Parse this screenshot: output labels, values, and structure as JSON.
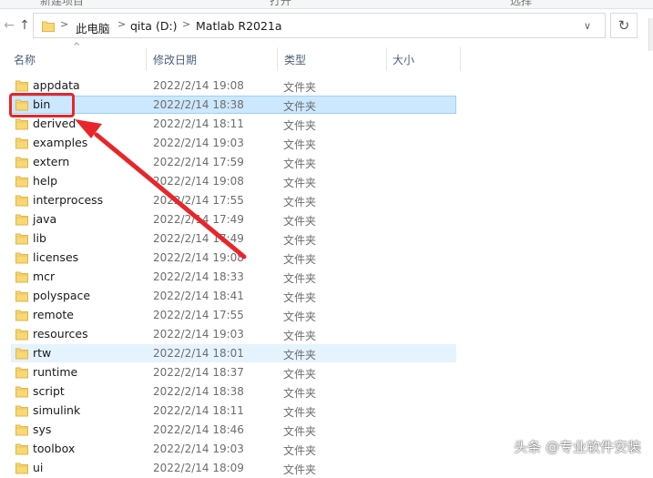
{
  "ribbon": {
    "labels": [
      "新建项目",
      "打开",
      "选择"
    ]
  },
  "nav": {
    "back_glyph": "←",
    "up_glyph": "↑",
    "dropdown_glyph": "∨",
    "refresh_glyph": "↻"
  },
  "breadcrumb": {
    "sep": ">",
    "items": [
      "此电脑",
      "qita (D:)",
      "Matlab R2021a"
    ]
  },
  "columns": {
    "sort_glyph": "^",
    "name": "名称",
    "date": "修改日期",
    "type": "类型",
    "size": "大小"
  },
  "files": [
    {
      "name": "appdata",
      "date": "2022/2/14 19:08",
      "type": "文件夹"
    },
    {
      "name": "bin",
      "date": "2022/2/14 18:38",
      "type": "文件夹",
      "state": "selected"
    },
    {
      "name": "derived",
      "date": "2022/2/14 18:11",
      "type": "文件夹"
    },
    {
      "name": "examples",
      "date": "2022/2/14 19:03",
      "type": "文件夹"
    },
    {
      "name": "extern",
      "date": "2022/2/14 17:59",
      "type": "文件夹"
    },
    {
      "name": "help",
      "date": "2022/2/14 19:08",
      "type": "文件夹"
    },
    {
      "name": "interprocess",
      "date": "2022/2/14 17:55",
      "type": "文件夹"
    },
    {
      "name": "java",
      "date": "2022/2/14 17:49",
      "type": "文件夹"
    },
    {
      "name": "lib",
      "date": "2022/2/14 17:49",
      "type": "文件夹"
    },
    {
      "name": "licenses",
      "date": "2022/2/14 19:08",
      "type": "文件夹"
    },
    {
      "name": "mcr",
      "date": "2022/2/14 18:33",
      "type": "文件夹"
    },
    {
      "name": "polyspace",
      "date": "2022/2/14 18:41",
      "type": "文件夹"
    },
    {
      "name": "remote",
      "date": "2022/2/14 17:55",
      "type": "文件夹"
    },
    {
      "name": "resources",
      "date": "2022/2/14 19:03",
      "type": "文件夹"
    },
    {
      "name": "rtw",
      "date": "2022/2/14 18:01",
      "type": "文件夹",
      "state": "hover"
    },
    {
      "name": "runtime",
      "date": "2022/2/14 18:37",
      "type": "文件夹"
    },
    {
      "name": "script",
      "date": "2022/2/14 18:38",
      "type": "文件夹"
    },
    {
      "name": "simulink",
      "date": "2022/2/14 18:11",
      "type": "文件夹"
    },
    {
      "name": "sys",
      "date": "2022/2/14 18:46",
      "type": "文件夹"
    },
    {
      "name": "toolbox",
      "date": "2022/2/14 19:03",
      "type": "文件夹"
    },
    {
      "name": "ui",
      "date": "2022/2/14 18:09",
      "type": "文件夹"
    }
  ],
  "annotation": {
    "color": "#e8262a",
    "target": "bin"
  },
  "watermark": {
    "text": "头条 @专业软件安装"
  },
  "colors": {
    "selected_bg": "#cce8ff",
    "selected_border": "#99d1ff",
    "hover_bg": "#e5f3ff",
    "folder": "#f8d775"
  }
}
